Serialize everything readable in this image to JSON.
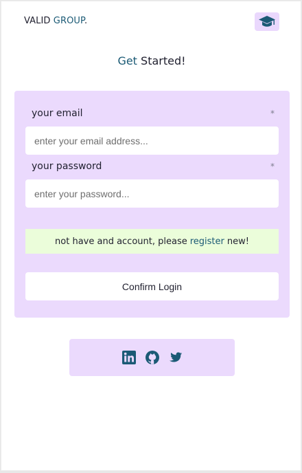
{
  "header": {
    "brand_part1": "VALID ",
    "brand_part2": "GROUP",
    "brand_dot": ".",
    "brand_icon": "graduation-cap-icon"
  },
  "title": {
    "part1": "Get",
    "part2": " Started!"
  },
  "form": {
    "email_label": "your email",
    "email_required": "*",
    "email_placeholder": "enter your email address...",
    "email_value": "",
    "password_label": "your password",
    "password_required": "*",
    "password_placeholder": "enter your password...",
    "password_value": ""
  },
  "notice": {
    "prefix": "not have and account, please",
    "link": "register",
    "suffix": "new!"
  },
  "confirm_label": "Confirm Login",
  "social": {
    "icons": [
      "linkedin-icon",
      "github-icon",
      "twitter-icon"
    ]
  },
  "colors": {
    "accent": "#1b5a75",
    "card_background": "#ebdafd",
    "notice_background": "#ebfdda"
  }
}
